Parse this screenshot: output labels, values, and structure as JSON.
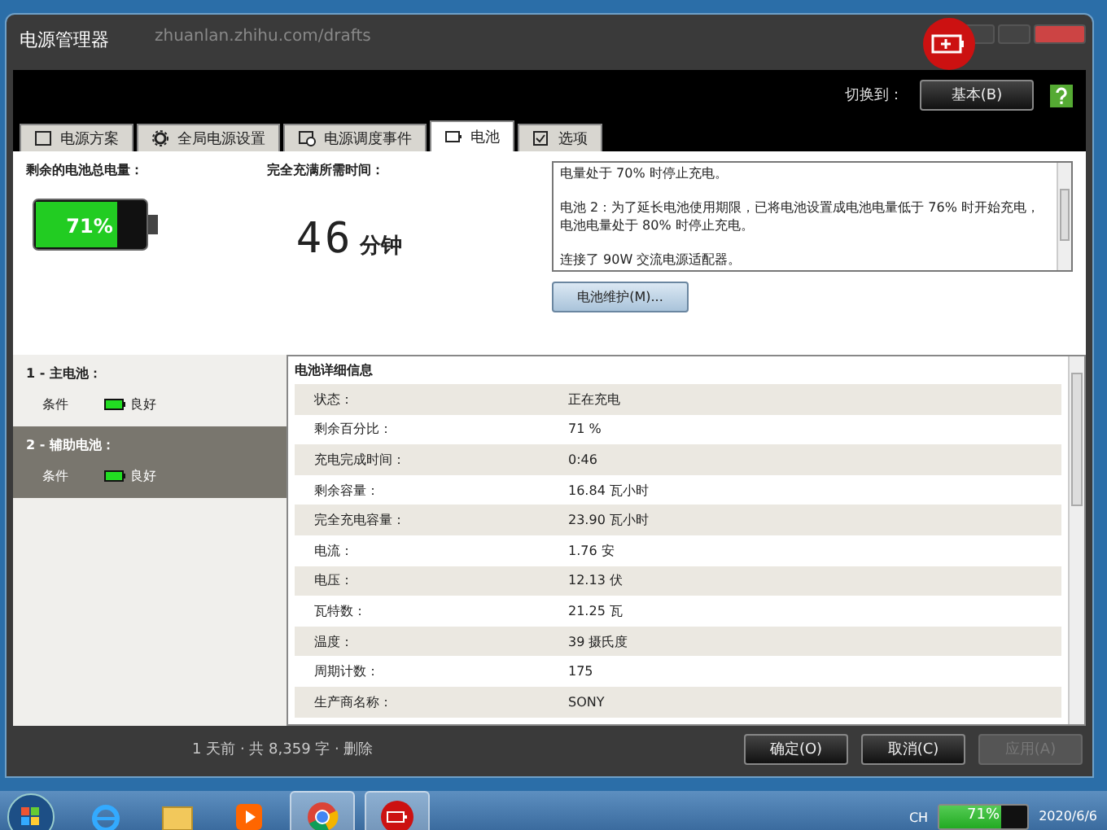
{
  "window": {
    "title": "电源管理器"
  },
  "background_page": {
    "url": "zhuanlan.zhihu.com/drafts",
    "meta": "1 天前 · 共 8,359 字 · 删除"
  },
  "toolbar": {
    "switch_label": "切换到：",
    "mode_button": "基本(B)"
  },
  "tabs": [
    {
      "label": "电源方案",
      "selected": false
    },
    {
      "label": "全局电源设置",
      "selected": false
    },
    {
      "label": "电源调度事件",
      "selected": false
    },
    {
      "label": "电池",
      "selected": true
    },
    {
      "label": "选项",
      "selected": false
    }
  ],
  "summary": {
    "remaining_label": "剩余的电池总电量：",
    "level": 0.71,
    "percent": "71%",
    "time_label": "完全充满所需时间：",
    "time_value": "46",
    "time_unit": "分钟"
  },
  "messages": [
    "电量处于 70% 时停止充电。",
    "电池 2：为了延长电池使用期限，已将电池设置成电池电量低于 76% 时开始充电，电池电量处于 80% 时停止充电。",
    "连接了 90W 交流电源适配器。"
  ],
  "maintenance_button": "电池维护(M)...",
  "batteries": [
    {
      "title": "1 - 主电池：",
      "condition_label": "条件",
      "condition_value": "良好",
      "selected": false
    },
    {
      "title": "2 - 辅助电池：",
      "condition_label": "条件",
      "condition_value": "良好",
      "selected": true
    }
  ],
  "details": {
    "title": "电池详细信息",
    "rows": [
      {
        "label": "状态：",
        "value": "正在充电"
      },
      {
        "label": "剩余百分比：",
        "value": "71 %"
      },
      {
        "label": "充电完成时间：",
        "value": "0:46"
      },
      {
        "label": "剩余容量：",
        "value": "16.84 瓦小时"
      },
      {
        "label": "完全充电容量：",
        "value": "23.90 瓦小时"
      },
      {
        "label": "电流：",
        "value": "1.76 安"
      },
      {
        "label": "电压：",
        "value": "12.13 伏"
      },
      {
        "label": "瓦特数：",
        "value": "21.25 瓦"
      },
      {
        "label": "温度：",
        "value": "39 摄氏度"
      },
      {
        "label": "周期计数：",
        "value": "175"
      },
      {
        "label": "生产商名称：",
        "value": "SONY"
      }
    ]
  },
  "buttons": [
    {
      "label": "确定(O)",
      "disabled": false
    },
    {
      "label": "取消(C)",
      "disabled": false
    },
    {
      "label": "应用(A)",
      "disabled": true
    }
  ],
  "taskbar": {
    "apps": [
      {
        "kind": "ie",
        "active": false
      },
      {
        "kind": "folder",
        "active": false
      },
      {
        "kind": "media",
        "active": false
      },
      {
        "kind": "chrome",
        "active": true
      },
      {
        "kind": "power",
        "active": true
      }
    ],
    "tray": {
      "language": "CH",
      "battery_percent": "71%",
      "level": 0.71,
      "date": "2020/6/6"
    }
  }
}
